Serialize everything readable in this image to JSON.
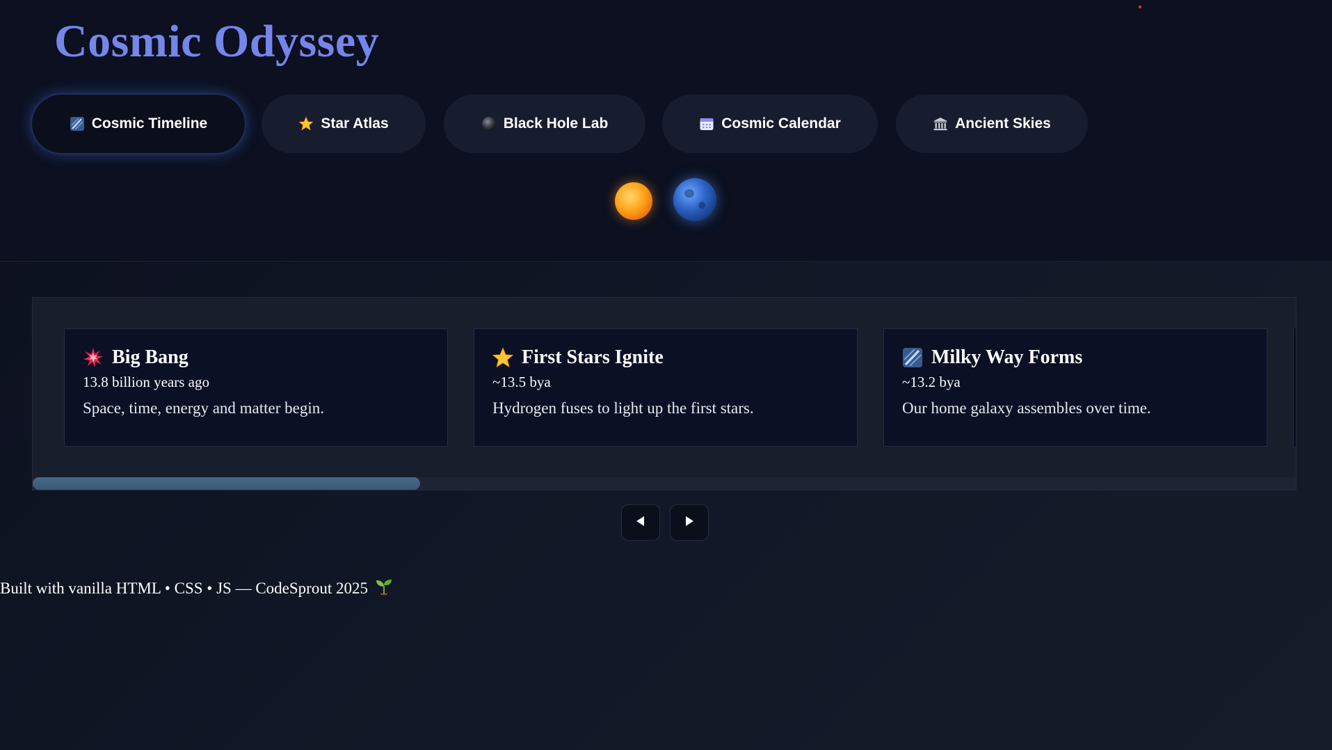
{
  "site": {
    "title": "Cosmic Odyssey"
  },
  "tabs": [
    {
      "label": "Cosmic Timeline",
      "icon": "milky-way-icon",
      "active": true
    },
    {
      "label": "Star Atlas",
      "icon": "star-icon",
      "active": false
    },
    {
      "label": "Black Hole Lab",
      "icon": "black-hole-icon",
      "active": false
    },
    {
      "label": "Cosmic Calendar",
      "icon": "calendar-icon",
      "active": false
    },
    {
      "label": "Ancient Skies",
      "icon": "temple-icon",
      "active": false
    }
  ],
  "theme_toggles": {
    "sun_icon": "sun-icon",
    "moon_icon": "moon-icon"
  },
  "timeline": {
    "events": [
      {
        "title": "Big Bang",
        "date": "13.8 billion years ago",
        "description": "Space, time, energy and matter begin.",
        "icon": "explosion-icon"
      },
      {
        "title": "First Stars Ignite",
        "date": "~13.5 bya",
        "description": "Hydrogen fuses to light up the first stars.",
        "icon": "star-icon"
      },
      {
        "title": "Milky Way Forms",
        "date": "~13.2 bya",
        "description": "Our home galaxy assembles over time.",
        "icon": "milky-way-icon"
      }
    ],
    "scroll_position": 0.0
  },
  "nav": {
    "prev_icon": "triangle-left-icon",
    "next_icon": "triangle-right-icon"
  },
  "footer": {
    "text": "Built with vanilla HTML • CSS • JS — CodeSprout 2025",
    "icon": "seedling-icon"
  },
  "colors": {
    "title": "#7585ea",
    "background": "#0c1020",
    "panel": "#181e2c",
    "card": "#0b1024",
    "scroll_thumb": "#4a6888",
    "accent_glow": "#5082ff"
  }
}
